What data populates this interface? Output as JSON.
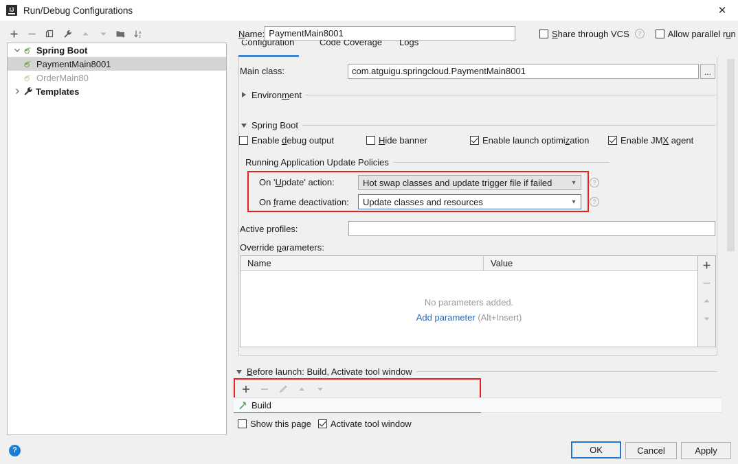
{
  "window": {
    "title": "Run/Debug Configurations",
    "app_icon": "intellij-idea-icon",
    "close_label": "✕"
  },
  "left_toolbar": {
    "items": [
      {
        "name": "add-configuration-button",
        "icon": "plus-icon",
        "label": "+"
      },
      {
        "name": "remove-configuration-button",
        "icon": "minus-icon",
        "label": "−"
      },
      {
        "name": "copy-configuration-button",
        "icon": "copy-icon",
        "label": ""
      },
      {
        "name": "edit-templates-button",
        "icon": "wrench-icon",
        "label": ""
      },
      {
        "name": "move-up-button",
        "icon": "arrow-up-icon",
        "label": ""
      },
      {
        "name": "move-down-button",
        "icon": "arrow-down-icon",
        "label": ""
      },
      {
        "name": "move-into-folder-button",
        "icon": "folder-add-icon",
        "label": ""
      },
      {
        "name": "sort-configurations-button",
        "icon": "sort-alpha-icon",
        "label": ""
      }
    ]
  },
  "tree": {
    "nodes": [
      {
        "label": "Spring Boot",
        "icon": "spring-boot-icon",
        "expanded": true,
        "bold": true,
        "level": 0,
        "selected": false,
        "dim": false
      },
      {
        "label": "PaymentMain8001",
        "icon": "spring-boot-icon",
        "level": 1,
        "selected": true,
        "bold": false,
        "dim": false
      },
      {
        "label": "OrderMain80",
        "icon": "spring-boot-icon",
        "level": 1,
        "selected": false,
        "bold": false,
        "dim": true
      },
      {
        "label": "Templates",
        "icon": "wrench-icon",
        "expanded": false,
        "bold": true,
        "level": 0,
        "selected": false,
        "dim": false
      }
    ]
  },
  "header": {
    "name_label": "Name:",
    "name_value": "PaymentMain8001",
    "share_through_vcs": {
      "label": "Share through VCS",
      "checked": false
    },
    "share_help_icon": "help-icon",
    "allow_parallel_run": {
      "label": "Allow parallel run",
      "checked": false
    }
  },
  "tabs": [
    {
      "label": "Configuration",
      "active": true
    },
    {
      "label": "Code Coverage",
      "active": false
    },
    {
      "label": "Logs",
      "active": false
    }
  ],
  "configuration": {
    "main_class_label": "Main class:",
    "main_class_value": "com.atguigu.springcloud.PaymentMain8001",
    "browse_button_label": "...",
    "environment_section": {
      "label": "Environment",
      "expanded": false
    },
    "spring_boot_section": {
      "label": "Spring Boot",
      "expanded": true
    },
    "checkboxes": [
      {
        "name": "enable-debug-output-checkbox",
        "label": "Enable debug output",
        "checked": false
      },
      {
        "name": "hide-banner-checkbox",
        "label": "Hide banner",
        "checked": false
      },
      {
        "name": "enable-launch-optimization-checkbox",
        "label": "Enable launch optimization",
        "checked": true
      },
      {
        "name": "enable-jmx-agent-checkbox",
        "label": "Enable JMX agent",
        "checked": true
      }
    ],
    "update_policies": {
      "section_label": "Running Application Update Policies",
      "on_update_label": "On 'Update' action:",
      "on_update_value": "Hot swap classes and update trigger file if failed",
      "on_frame_deactivation_label": "On frame deactivation:",
      "on_frame_deactivation_value": "Update classes and resources",
      "highlight_color": "#ee1c1c"
    },
    "active_profiles_label": "Active profiles:",
    "active_profiles_value": "",
    "override_parameters_label": "Override parameters:",
    "parameters_table": {
      "columns": [
        "Name",
        "Value"
      ],
      "rows": [],
      "empty_text": "No parameters added.",
      "add_link": "Add parameter",
      "add_hint": "(Alt+Insert)",
      "side_buttons": [
        {
          "name": "add-parameter-button",
          "icon": "plus-icon"
        },
        {
          "name": "remove-parameter-button",
          "icon": "minus-icon"
        },
        {
          "name": "move-parameter-up-button",
          "icon": "arrow-up-icon"
        },
        {
          "name": "move-parameter-down-button",
          "icon": "arrow-down-icon"
        }
      ]
    }
  },
  "before_launch": {
    "section_label": "Before launch: Build, Activate tool window",
    "toolbar": [
      {
        "name": "add-task-button",
        "icon": "plus-icon"
      },
      {
        "name": "remove-task-button",
        "icon": "minus-icon"
      },
      {
        "name": "edit-task-button",
        "icon": "pencil-icon"
      },
      {
        "name": "move-task-up-button",
        "icon": "arrow-up-icon"
      },
      {
        "name": "move-task-down-button",
        "icon": "arrow-down-icon"
      }
    ],
    "tasks": [
      {
        "label": "Build",
        "icon": "hammer-icon"
      }
    ],
    "show_this_page": {
      "label": "Show this page",
      "checked": false
    },
    "activate_tool_window": {
      "label": "Activate tool window",
      "checked": true
    },
    "highlight_color": "#ee1c1c"
  },
  "footer": {
    "help_icon": "help-icon",
    "ok_label": "OK",
    "cancel_label": "Cancel",
    "apply_label": "Apply"
  }
}
